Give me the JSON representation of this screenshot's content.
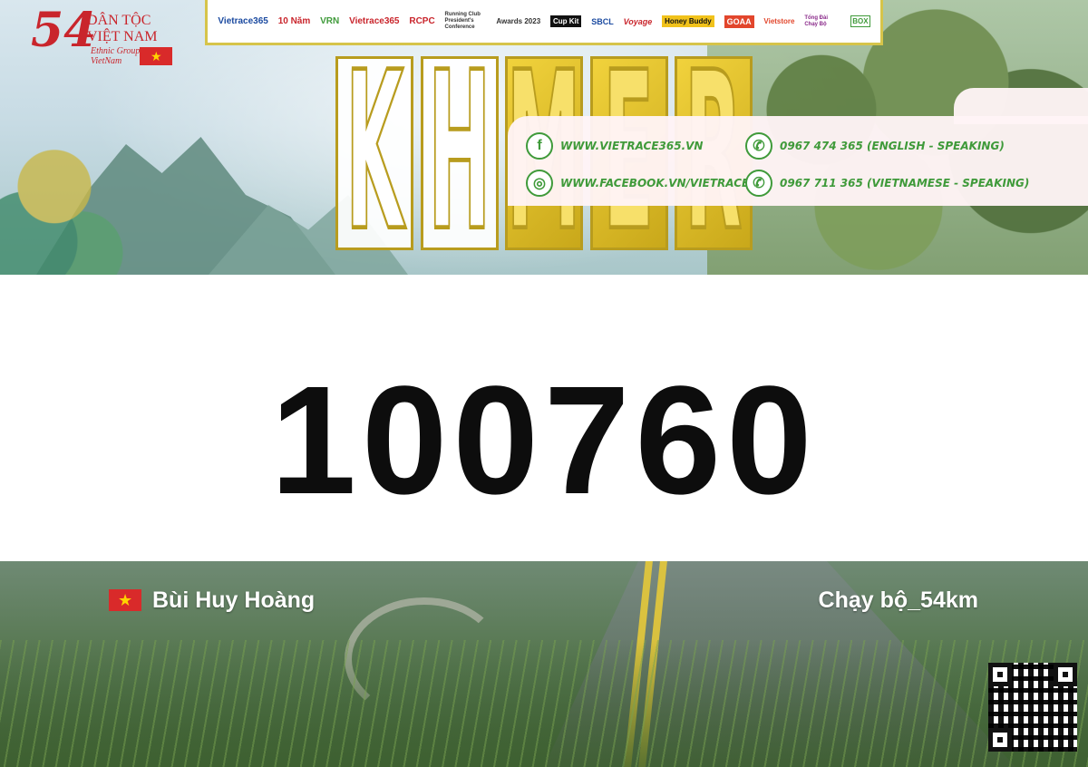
{
  "header": {
    "logo_number": "54",
    "logo_line1": "DÂN TỘC",
    "logo_line2": "VIỆT NAM",
    "logo_line3": "Ethnic Group In VietNam",
    "sponsors": [
      "Vietrace365",
      "10 Năm",
      "VRN",
      "Vietrace365",
      "RCPC",
      "Running Club President's Conference",
      "Awards 2023",
      "Cup Kit",
      "SBCL",
      "Voyage",
      "Honey Buddy",
      "GOAA",
      "Vietstore",
      "Tổng Đài Chạy Bộ",
      "BOX"
    ],
    "title_letters": [
      "K",
      "H",
      "M",
      "E",
      "R"
    ]
  },
  "bib": {
    "number": "100760"
  },
  "runner": {
    "name": "Bùi Huy Hoàng",
    "category": "Chạy bộ_54km"
  },
  "contact": {
    "website": "WWW.VIETRACE365.VN",
    "facebook": "WWW.FACEBOOK.VN/VIETRACE365",
    "phone_en": "0967 474 365 (ENGLISH - SPEAKING)",
    "phone_vn": "0967 711 365 (VIETNAMESE - SPEAKING)"
  },
  "colors": {
    "gold": "#d6c44a",
    "red": "#c9252c",
    "contact_green": "#3f9a3a",
    "bib_text": "#0d0d0d"
  },
  "icons": {
    "facebook": "facebook-icon",
    "globe": "globe-icon",
    "phone": "phone-icon",
    "flag": "vietnam-flag-icon"
  }
}
